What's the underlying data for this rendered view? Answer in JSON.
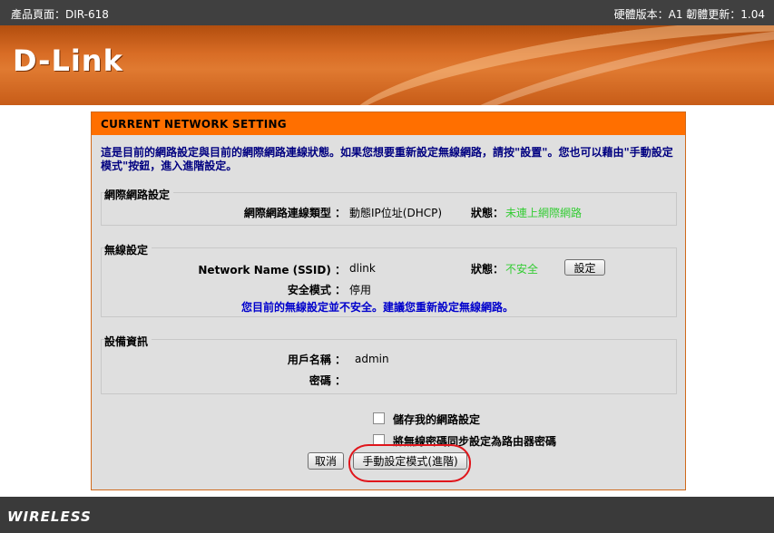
{
  "topbar": {
    "product": "產品頁面：DIR-618",
    "versions": "硬體版本：A1   韌體更新：1.04"
  },
  "banner": {
    "logo": "D-Link"
  },
  "panel": {
    "title": "CURRENT NETWORK SETTING",
    "intro": "這是目前的網路設定與目前的網際網路連線狀態。如果您想要重新設定無線網路，請按\"設置\"。您也可以藉由\"手動設定模式\"按鈕，進入進階設定。",
    "internet": {
      "legend": "網際網路設定",
      "conn_type_label": "網際網路連線類型 ：",
      "conn_type_value": "動態IP位址(DHCP)",
      "status_label": "狀態：",
      "status_value": "未連上網際網路"
    },
    "wireless": {
      "legend": "無線設定",
      "ssid_label": "Network Name (SSID) ：",
      "ssid_value": "dlink",
      "status_label": "狀態：",
      "status_value": "不安全",
      "setup_button": "設定",
      "security_label": "安全模式 ：",
      "security_value": "停用",
      "warning": "您目前的無線設定並不安全。建議您重新設定無線網路。"
    },
    "device": {
      "legend": "設備資訊",
      "user_label": "用戶名稱 ：",
      "user_value": "admin",
      "pass_label": "密碼 ：",
      "pass_value": ""
    },
    "save_network_label": "儲存我的網路設定",
    "sync_password_label": "將無線密碼同步設定為路由器密碼",
    "cancel_button": "取消",
    "manual_button": "手動設定模式(進階)"
  },
  "footer": {
    "brand": "WIRELESS"
  },
  "colors": {
    "accent": "#ff6f00",
    "status_green": "#33cc33",
    "warning_blue": "#0000cc",
    "highlight_circle": "#e0151b"
  }
}
